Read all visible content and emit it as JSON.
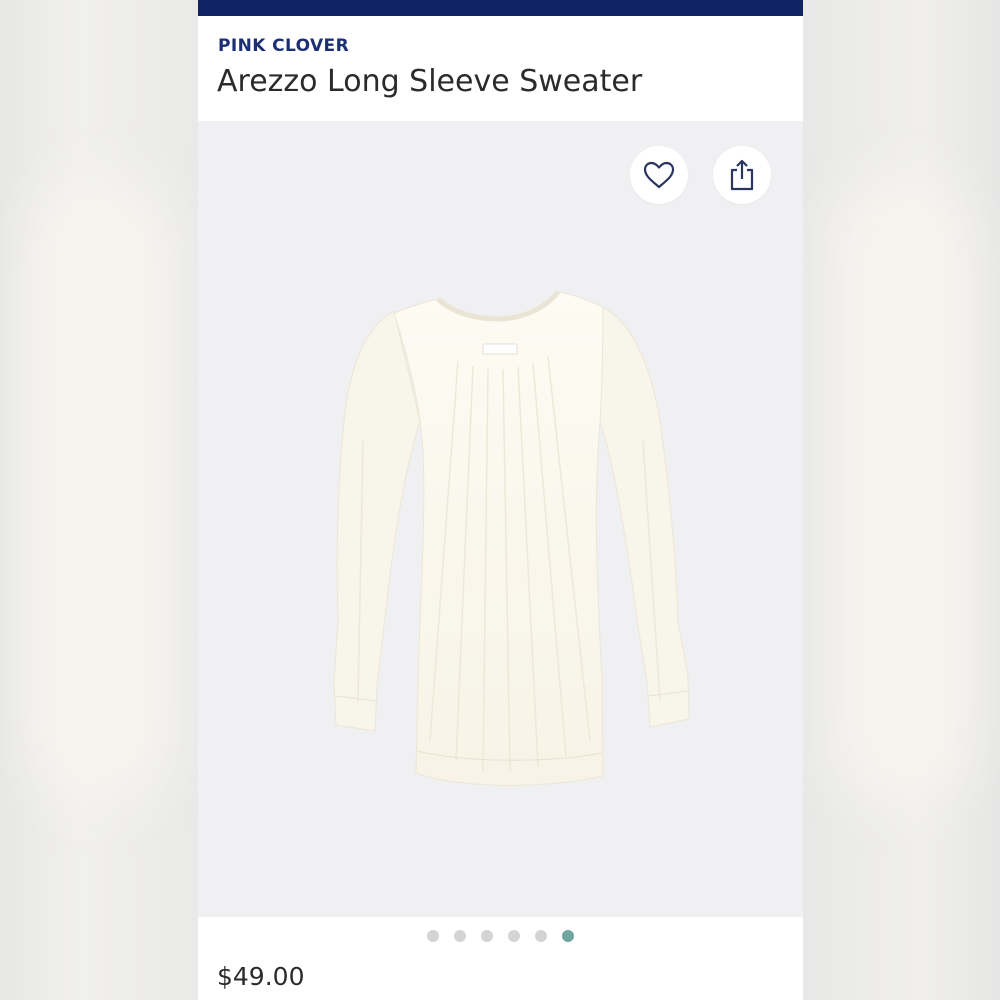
{
  "product": {
    "brand": "PINK CLOVER",
    "title": "Arezzo Long Sleeve Sweater",
    "price": "$49.00"
  },
  "actions": {
    "favorite_icon": "heart-icon",
    "share_icon": "share-icon"
  },
  "gallery": {
    "total_images": 6,
    "active_index": 5
  },
  "colors": {
    "top_bar": "#0f2365",
    "brand": "#1c2f73",
    "active_dot": "#6fa6a2",
    "inactive_dot": "#d4d4d6",
    "image_background": "#f0f0f2"
  }
}
